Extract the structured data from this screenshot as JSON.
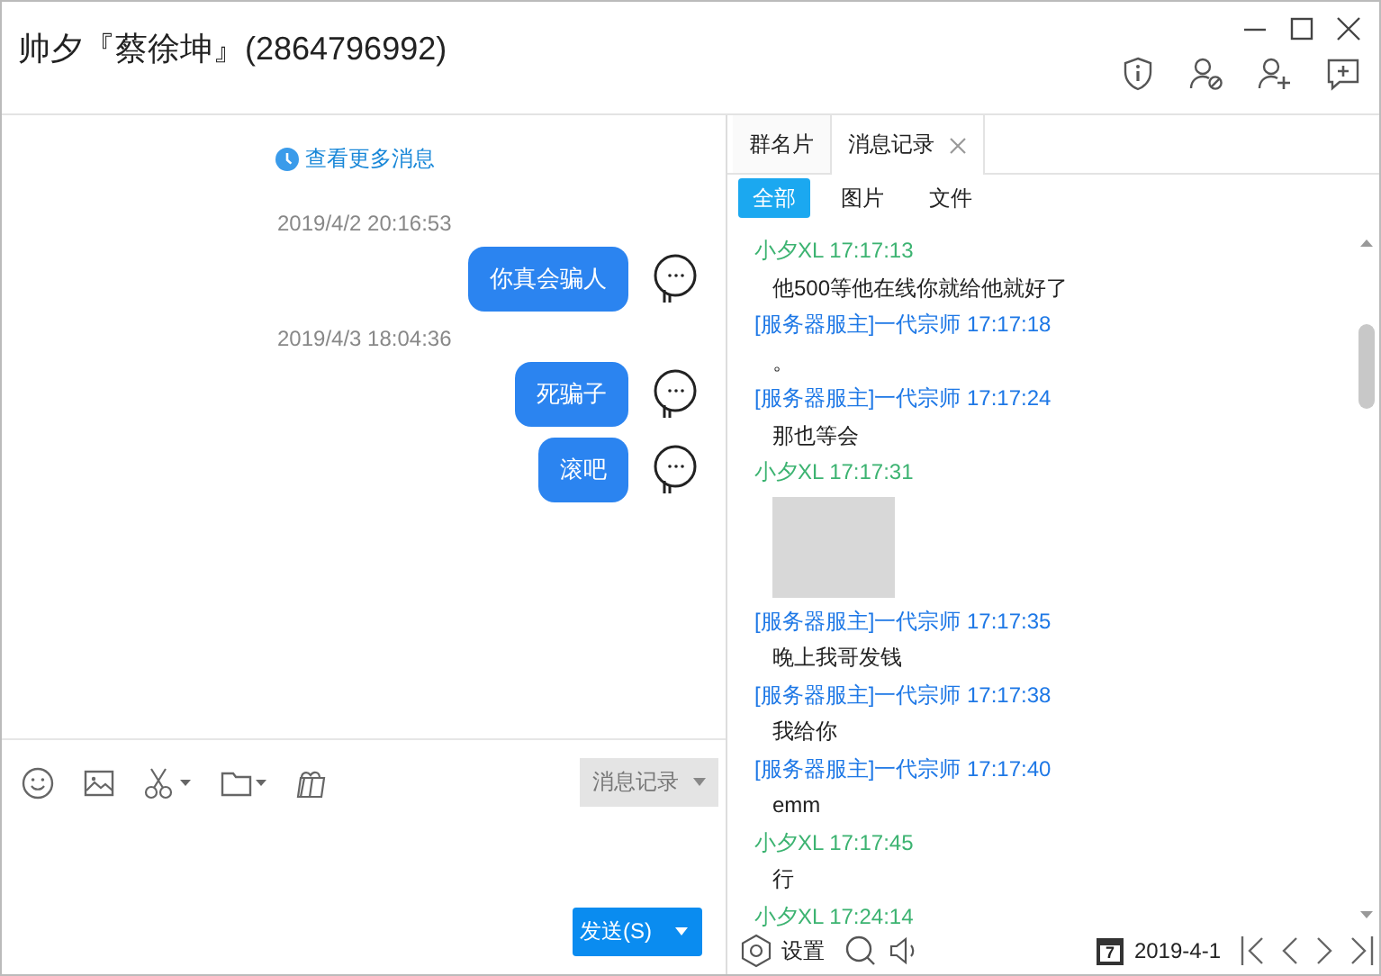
{
  "window": {
    "title": "帅夕『蔡徐坤』(2864796992)"
  },
  "chat": {
    "more_link": "查看更多消息",
    "items": [
      {
        "kind": "time",
        "text": "2019/4/2 20:16:53"
      },
      {
        "kind": "message",
        "text": "你真会骗人"
      },
      {
        "kind": "time",
        "text": "2019/4/3 18:04:36"
      },
      {
        "kind": "message",
        "text": "死骗子"
      },
      {
        "kind": "message",
        "text": "滚吧"
      }
    ]
  },
  "composer": {
    "history_button": "消息记录",
    "send_button": "发送(S)"
  },
  "side_tabs": [
    {
      "label": "群名片",
      "selected": false
    },
    {
      "label": "消息记录",
      "selected": true
    }
  ],
  "filters": [
    {
      "label": "全部",
      "selected": true
    },
    {
      "label": "图片",
      "selected": false
    },
    {
      "label": "文件",
      "selected": false
    }
  ],
  "history": [
    {
      "kind": "text",
      "header": "小夕XL 17:17:13",
      "color": "#3cb371",
      "text": "他500等他在线你就给他就好了"
    },
    {
      "kind": "text",
      "header": "[服务器服主]一代宗师 17:17:18",
      "color": "#1e78e6",
      "text": "。"
    },
    {
      "kind": "text",
      "header": "[服务器服主]一代宗师 17:17:24",
      "color": "#1e78e6",
      "text": "那也等会"
    },
    {
      "kind": "image",
      "header": "小夕XL 17:17:31",
      "color": "#3cb371"
    },
    {
      "kind": "text",
      "header": "[服务器服主]一代宗师 17:17:35",
      "color": "#1e78e6",
      "text": "晚上我哥发钱"
    },
    {
      "kind": "text",
      "header": "[服务器服主]一代宗师 17:17:38",
      "color": "#1e78e6",
      "text": "我给你"
    },
    {
      "kind": "text",
      "header": "[服务器服主]一代宗师 17:17:40",
      "color": "#1e78e6",
      "text": "emm"
    },
    {
      "kind": "text",
      "header": "小夕XL 17:17:45",
      "color": "#3cb371",
      "text": "行"
    },
    {
      "kind": "header",
      "header": "小夕XL 17:24:14",
      "color": "#3cb371"
    }
  ],
  "history_footer": {
    "settings": "设置",
    "calendar_day": "7",
    "date": "2019-4-1"
  }
}
